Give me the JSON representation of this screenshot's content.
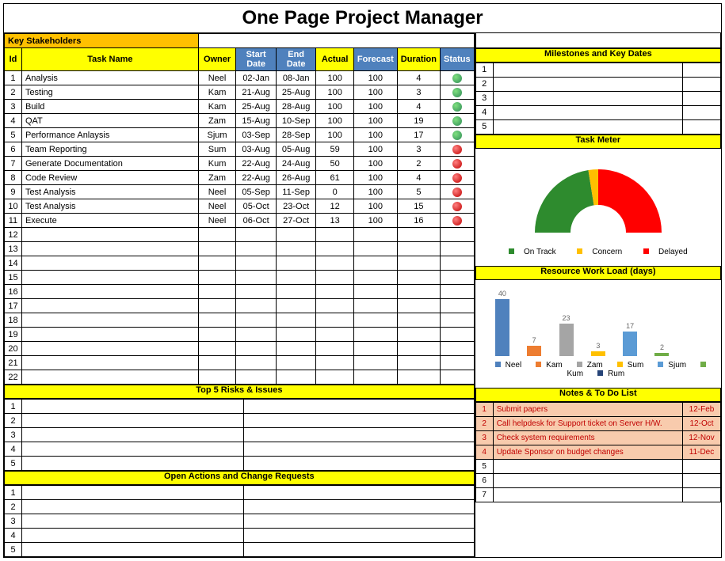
{
  "title": "One Page Project Manager",
  "stakeholders_label": "Key Stakeholders",
  "task_headers": {
    "id": "Id",
    "name": "Task Name",
    "owner": "Owner",
    "start": "Start Date",
    "end": "End Date",
    "actual": "Actual",
    "forecast": "Forecast",
    "duration": "Duration",
    "status": "Status"
  },
  "tasks": [
    {
      "id": "1",
      "name": "Analysis",
      "owner": "Neel",
      "start": "02-Jan",
      "end": "08-Jan",
      "actual": "100",
      "forecast": "100",
      "duration": "4",
      "status": "green"
    },
    {
      "id": "2",
      "name": "Testing",
      "owner": "Kam",
      "start": "21-Aug",
      "end": "25-Aug",
      "actual": "100",
      "forecast": "100",
      "duration": "3",
      "status": "green"
    },
    {
      "id": "3",
      "name": "Build",
      "owner": "Kam",
      "start": "25-Aug",
      "end": "28-Aug",
      "actual": "100",
      "forecast": "100",
      "duration": "4",
      "status": "green"
    },
    {
      "id": "4",
      "name": "QAT",
      "owner": "Zam",
      "start": "15-Aug",
      "end": "10-Sep",
      "actual": "100",
      "forecast": "100",
      "duration": "19",
      "status": "green"
    },
    {
      "id": "5",
      "name": "Performance Anlaysis",
      "owner": "Sjum",
      "start": "03-Sep",
      "end": "28-Sep",
      "actual": "100",
      "forecast": "100",
      "duration": "17",
      "status": "green"
    },
    {
      "id": "6",
      "name": "Team Reporting",
      "owner": "Sum",
      "start": "03-Aug",
      "end": "05-Aug",
      "actual": "59",
      "forecast": "100",
      "duration": "3",
      "status": "red"
    },
    {
      "id": "7",
      "name": "Generate Documentation",
      "owner": "Kum",
      "start": "22-Aug",
      "end": "24-Aug",
      "actual": "50",
      "forecast": "100",
      "duration": "2",
      "status": "red"
    },
    {
      "id": "8",
      "name": "Code Review",
      "owner": "Zam",
      "start": "22-Aug",
      "end": "26-Aug",
      "actual": "61",
      "forecast": "100",
      "duration": "4",
      "status": "red"
    },
    {
      "id": "9",
      "name": "Test Analysis",
      "owner": "Neel",
      "start": "05-Sep",
      "end": "11-Sep",
      "actual": "0",
      "forecast": "100",
      "duration": "5",
      "status": "red"
    },
    {
      "id": "10",
      "name": "Test Analysis",
      "owner": "Neel",
      "start": "05-Oct",
      "end": "23-Oct",
      "actual": "12",
      "forecast": "100",
      "duration": "15",
      "status": "red"
    },
    {
      "id": "11",
      "name": "Execute",
      "owner": "Neel",
      "start": "06-Oct",
      "end": "27-Oct",
      "actual": "13",
      "forecast": "100",
      "duration": "16",
      "status": "red"
    }
  ],
  "empty_task_ids": [
    "12",
    "13",
    "14",
    "15",
    "16",
    "17",
    "18",
    "19",
    "20",
    "21",
    "22"
  ],
  "risks_header": "Top 5 Risks & Issues",
  "risks_ids": [
    "1",
    "2",
    "3",
    "4",
    "5"
  ],
  "actions_header": "Open Actions and Change Requests",
  "actions_ids": [
    "1",
    "2",
    "3",
    "4",
    "5"
  ],
  "milestones_header": "Milestones and Key Dates",
  "milestones_ids": [
    "1",
    "2",
    "3",
    "4",
    "5"
  ],
  "taskmeter_header": "Task Meter",
  "taskmeter_legend": {
    "on_track": "On Track",
    "concern": "Concern",
    "delayed": "Delayed"
  },
  "workload_header": "Resource Work Load (days)",
  "notes_header": "Notes & To Do List",
  "notes": [
    {
      "id": "1",
      "text": "Submit papers",
      "date": "12-Feb",
      "red": true
    },
    {
      "id": "2",
      "text": "Call helpdesk for Support ticket on Server H/W.",
      "date": "12-Oct",
      "red": true
    },
    {
      "id": "3",
      "text": "Check system requirements",
      "date": "12-Nov",
      "red": true
    },
    {
      "id": "4",
      "text": "Update Sponsor on budget changes",
      "date": "11-Dec",
      "red": true
    },
    {
      "id": "5",
      "text": "",
      "date": "",
      "red": false
    },
    {
      "id": "6",
      "text": "",
      "date": "",
      "red": false
    },
    {
      "id": "7",
      "text": "",
      "date": "",
      "red": false
    }
  ],
  "chart_data": {
    "task_meter": {
      "type": "pie",
      "title": "Task Meter",
      "series": [
        {
          "name": "On Track",
          "value": 45,
          "color": "#2e8b2e"
        },
        {
          "name": "Concern",
          "value": 5,
          "color": "#ffc000"
        },
        {
          "name": "Delayed",
          "value": 50,
          "color": "#ff0000"
        }
      ]
    },
    "workload": {
      "type": "bar",
      "title": "Resource Work Load (days)",
      "categories": [
        "Neel",
        "Kam",
        "Zam",
        "Sum",
        "Sjum",
        "Kum",
        "Rum"
      ],
      "values": [
        40,
        7,
        23,
        3,
        17,
        2,
        0
      ],
      "colors": [
        "#4f81bd",
        "#ed7d31",
        "#a5a5a5",
        "#ffc000",
        "#5b9bd5",
        "#70ad47",
        "#264478"
      ],
      "ylim": [
        0,
        45
      ]
    }
  }
}
